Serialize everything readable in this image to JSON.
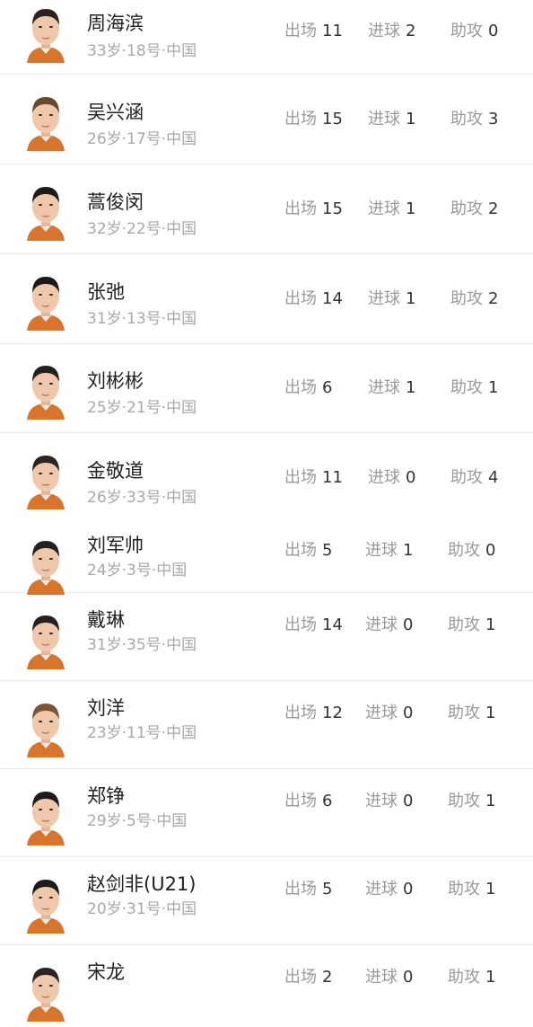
{
  "stat_labels": {
    "apps": "出场",
    "goals": "进球",
    "assists": "助攻"
  },
  "players": [
    {
      "name": "周海滨",
      "meta": "33岁·18号·中国",
      "apps": "11",
      "goals": "2",
      "assists": "0",
      "hair": "#2a2220"
    },
    {
      "name": "吴兴涵",
      "meta": "26岁·17号·中国",
      "apps": "15",
      "goals": "1",
      "assists": "3",
      "hair": "#6a4a2c"
    },
    {
      "name": "蒿俊闵",
      "meta": "32岁·22号·中国",
      "apps": "15",
      "goals": "1",
      "assists": "2",
      "hair": "#1f1b1a"
    },
    {
      "name": "张弛",
      "meta": "31岁·13号·中国",
      "apps": "14",
      "goals": "1",
      "assists": "2",
      "hair": "#1c1a19"
    },
    {
      "name": "刘彬彬",
      "meta": "25岁·21号·中国",
      "apps": "6",
      "goals": "1",
      "assists": "1",
      "hair": "#24201e"
    },
    {
      "name": "金敬道",
      "meta": "26岁·33号·中国",
      "apps": "11",
      "goals": "0",
      "assists": "4",
      "hair": "#2c2220"
    },
    {
      "name": "刘军帅",
      "meta": "24岁·3号·中国",
      "apps": "5",
      "goals": "1",
      "assists": "0",
      "hair": "#222020"
    },
    {
      "name": "戴琳",
      "meta": "31岁·35号·中国",
      "apps": "14",
      "goals": "0",
      "assists": "1",
      "hair": "#262120"
    },
    {
      "name": "刘洋",
      "meta": "23岁·11号·中国",
      "apps": "12",
      "goals": "0",
      "assists": "1",
      "hair": "#7a5634"
    },
    {
      "name": "郑铮",
      "meta": "29岁·5号·中国",
      "apps": "6",
      "goals": "0",
      "assists": "1",
      "hair": "#1e1b1a"
    },
    {
      "name": "赵剑非(U21)",
      "meta": "20岁·31号·中国",
      "apps": "5",
      "goals": "0",
      "assists": "1",
      "hair": "#1c1a1a"
    },
    {
      "name": "宋龙",
      "meta": "",
      "apps": "2",
      "goals": "0",
      "assists": "1",
      "hair": "#2a2321"
    }
  ]
}
